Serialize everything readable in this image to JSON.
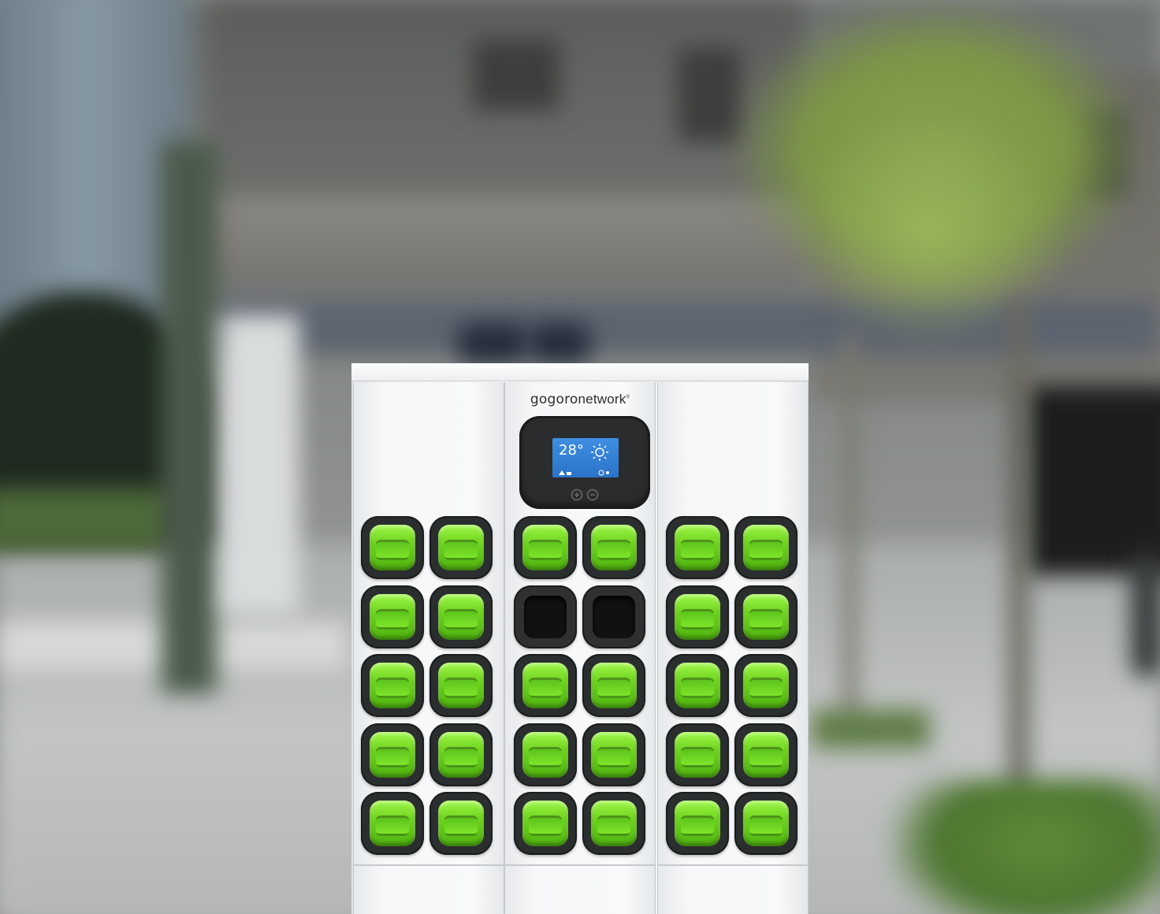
{
  "station": {
    "brand_logo": "gogoro",
    "brand_suffix": "network",
    "brand_mark": "®",
    "screen": {
      "temperature": "28°",
      "weather_icon": "sun-icon"
    },
    "kiosk_symbol": "plus-minus-loop-icon",
    "columns": [
      {
        "name": "left",
        "slots": [
          "charged",
          "charged",
          "charged",
          "charged",
          "charged",
          "charged",
          "charged",
          "charged",
          "charged",
          "charged"
        ]
      },
      {
        "name": "middle",
        "slots": [
          "charged",
          "charged",
          "empty",
          "empty",
          "charged",
          "charged",
          "charged",
          "charged",
          "charged",
          "charged"
        ]
      },
      {
        "name": "right",
        "slots": [
          "charged",
          "charged",
          "charged",
          "charged",
          "charged",
          "charged",
          "charged",
          "charged",
          "charged",
          "charged"
        ]
      }
    ],
    "colors": {
      "battery_green": "#6fd41e",
      "slot_dark": "#2b2e2f",
      "screen_blue": "#3f8fe2",
      "cabinet_white": "#f4f6f7"
    }
  }
}
